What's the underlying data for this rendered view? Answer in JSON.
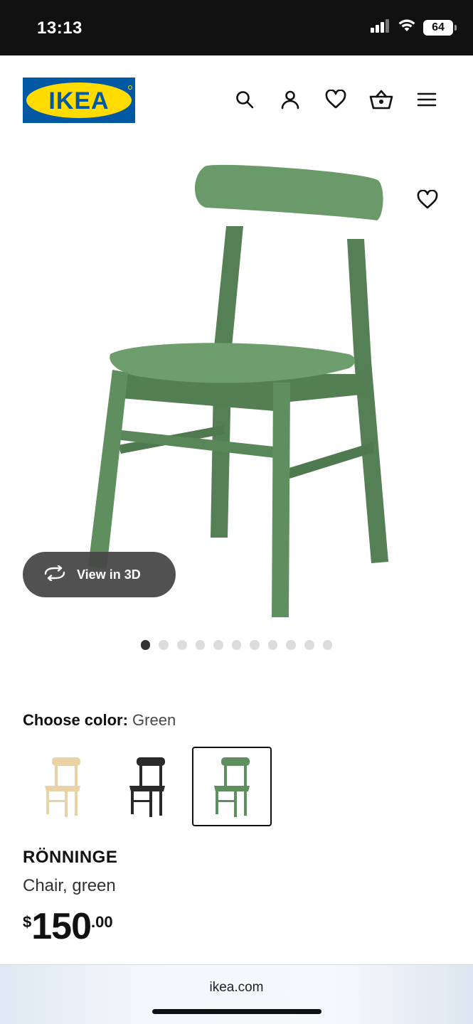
{
  "status_bar": {
    "time": "13:13",
    "battery": "64"
  },
  "header": {
    "logo_text": "IKEA",
    "brand_colors": {
      "blue": "#0058A3",
      "yellow": "#FFDB00"
    },
    "icons": [
      "search-icon",
      "account-icon",
      "heart-icon",
      "basket-icon",
      "menu-icon"
    ]
  },
  "hero": {
    "view_3d_label": "View in 3D",
    "image_count": 11,
    "active_image": 1
  },
  "color_picker": {
    "label": "Choose color:",
    "selected_value": "Green",
    "options": [
      {
        "name": "Birch",
        "color": "#E9D3A6"
      },
      {
        "name": "Black",
        "color": "#2A2A2A"
      },
      {
        "name": "Green",
        "color": "#5F8F5F"
      }
    ]
  },
  "product": {
    "name": "RÖNNINGE",
    "description": "Chair, green",
    "price_currency": "$",
    "price_integer": "150",
    "price_decimal": ".00",
    "chair_color": "#5F8F5F"
  },
  "browser": {
    "url": "ikea.com"
  }
}
